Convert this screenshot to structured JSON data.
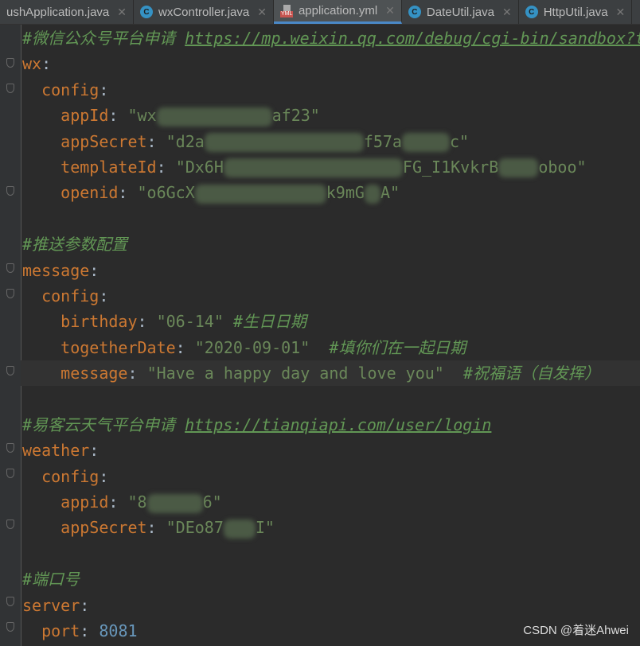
{
  "tabs": [
    {
      "label": "ushApplication.java",
      "icon": "java-class-icon",
      "active": false
    },
    {
      "label": "wxController.java",
      "icon": "java-class-icon",
      "active": false
    },
    {
      "label": "application.yml",
      "icon": "yml-file-icon",
      "active": true
    },
    {
      "label": "DateUtil.java",
      "icon": "java-class-icon",
      "active": false
    },
    {
      "label": "HttpUtil.java",
      "icon": "java-class-icon",
      "active": false
    }
  ],
  "code": {
    "c1": "#微信公众号平台申请 ",
    "c1_url": "https://mp.weixin.qq.com/debug/cgi-bin/sandbox?t=",
    "wx": "wx",
    "config": "config",
    "appId_key": "appId",
    "appId_a": "\"wx",
    "appId_b": "af23\"",
    "appSecret_key": "appSecret",
    "appSecret_a": "\"d2a",
    "appSecret_b": "f57a",
    "appSecret_c": "c\"",
    "templateId_key": "templateId",
    "templateId_a": "\"Dx6H",
    "templateId_b": "FG_I1KvkrB",
    "templateId_c": "oboo\"",
    "openid_key": "openid",
    "openid_a": "\"o6GcX",
    "openid_b": "k9mG",
    "openid_c": "A\"",
    "c2": "#推送参数配置",
    "message": "message",
    "birthday_key": "birthday",
    "birthday_val": "\"06-14\"",
    "birthday_comment": "#生日日期",
    "together_key": "togetherDate",
    "together_val": "\"2020-09-01\"",
    "together_comment": "#填你们在一起日期",
    "msg_key": "message",
    "msg_val": "\"Have a happy day and love you\"",
    "msg_comment": "#祝福语（自发挥）",
    "c3": "#易客云天气平台申请 ",
    "c3_url": "https://tianqiapi.com/user/login",
    "weather": "weather",
    "appid_key": "appid",
    "appid_a": "\"8",
    "appid_b": "6\"",
    "wsecret_key": "appSecret",
    "wsecret_a": "\"DEo87",
    "wsecret_b": "I\"",
    "c4": "#端口号",
    "server": "server",
    "port_key": "port",
    "port_val": "8081"
  },
  "watermark": "CSDN @着迷Ahwei"
}
